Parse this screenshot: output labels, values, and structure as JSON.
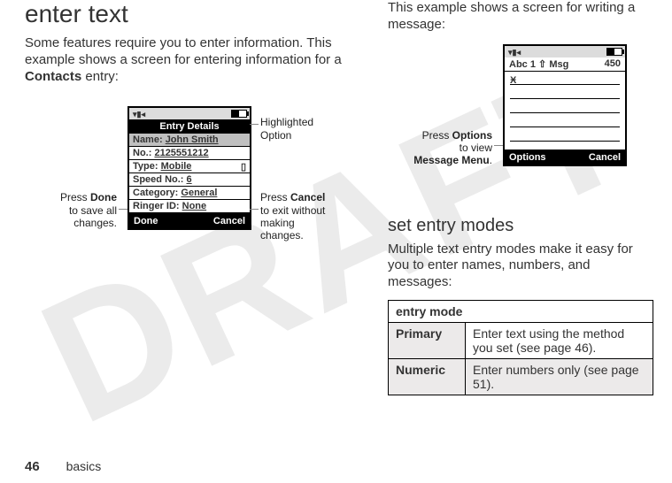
{
  "watermark": "DRAFT",
  "page_number": "46",
  "footer_label": "basics",
  "left": {
    "heading": "enter text",
    "para_pre": "Some features require you to enter information. This example shows a screen for entering information for a ",
    "para_bold": "Contacts",
    "para_post": " entry:",
    "phone": {
      "title": "Entry Details",
      "fields": [
        {
          "label": "Name:",
          "value": "John Smith",
          "highlight": true
        },
        {
          "label": "No.:",
          "value": "2125551212"
        },
        {
          "label": "Type:",
          "value": "Mobile"
        },
        {
          "label": "Speed No.:",
          "value": "6"
        },
        {
          "label": "Category:",
          "value": "General"
        },
        {
          "label": "Ringer ID:",
          "value": "None"
        }
      ],
      "soft_left": "Done",
      "soft_right": "Cancel"
    },
    "callouts": {
      "highlighted": "Highlighted Option",
      "done_pre": "Press ",
      "done_bold": "Done",
      "done_post": " to save all changes.",
      "cancel_pre": "Press ",
      "cancel_bold": "Cancel",
      "cancel_post": " to exit without making changes."
    }
  },
  "right": {
    "intro": "This example shows a screen for writing a message:",
    "phone": {
      "mode_label": "Abc 1",
      "msg_label": "Msg",
      "counter": "450",
      "soft_left": "Options",
      "soft_right": "Cancel"
    },
    "callouts": {
      "options_pre": "Press ",
      "options_bold": "Options",
      "options_mid": " to view ",
      "options_bold2": "Message Menu",
      "options_post": "."
    },
    "heading2": "set entry modes",
    "para2": "Multiple text entry modes make it easy for you to enter names, numbers, and messages:",
    "table": {
      "header": "entry mode",
      "rows": [
        {
          "mode": "Primary",
          "desc_pre": "Enter text using the method you set (see page ",
          "page": "46",
          "desc_post": ")."
        },
        {
          "mode": "Numeric",
          "desc_pre": "Enter numbers only (see page ",
          "page": "51",
          "desc_post": ")."
        }
      ]
    }
  }
}
